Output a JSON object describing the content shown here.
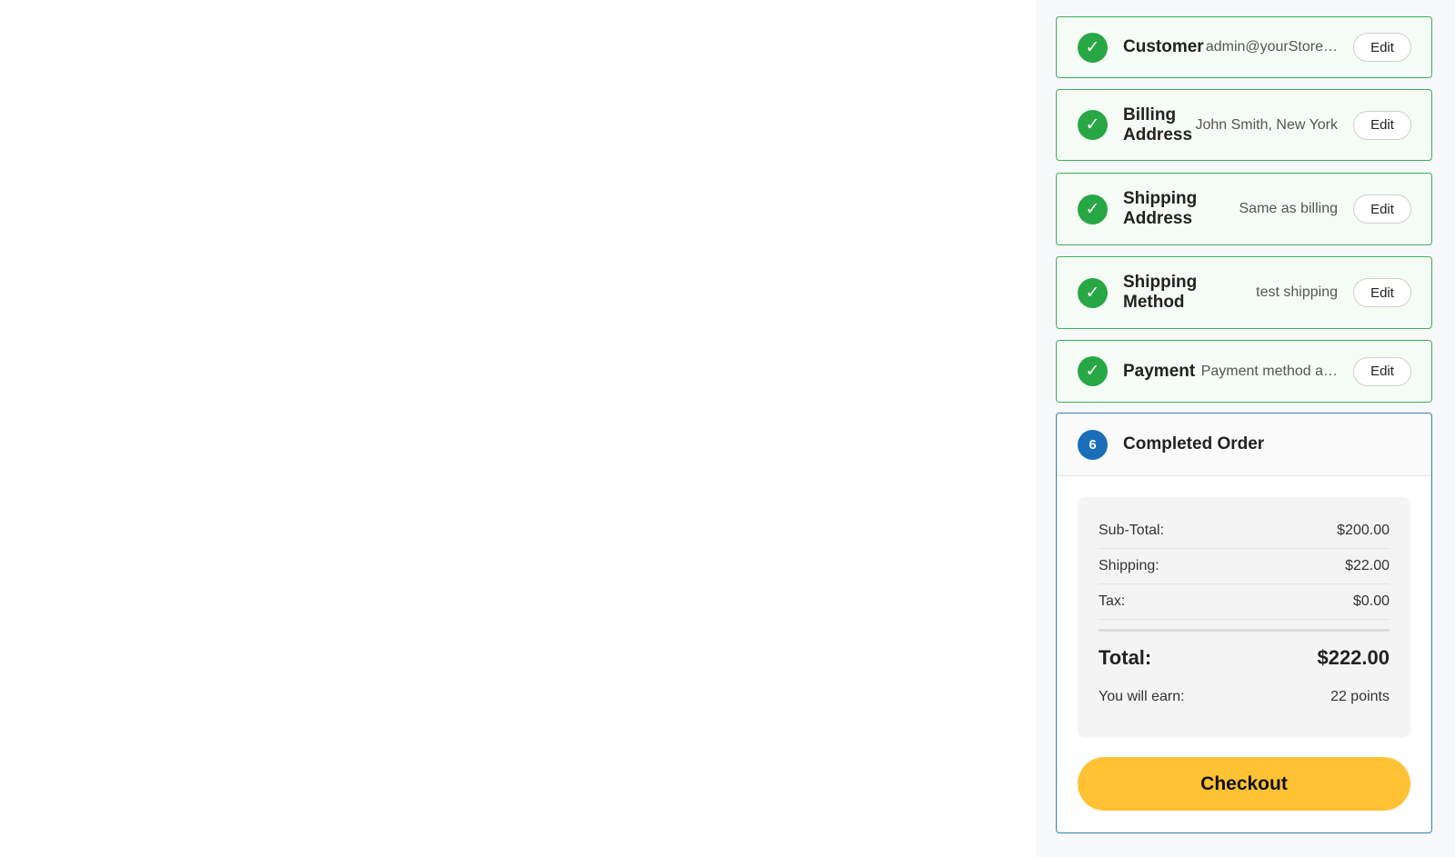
{
  "steps": [
    {
      "title": "Customer",
      "summary": "admin@yourStore…",
      "edit_label": "Edit",
      "status_icon": "check-icon"
    },
    {
      "title": "Billing Address",
      "summary": "John Smith, New York",
      "edit_label": "Edit",
      "status_icon": "check-icon"
    },
    {
      "title": "Shipping Address",
      "summary": "Same as billing",
      "edit_label": "Edit",
      "status_icon": "check-icon"
    },
    {
      "title": "Shipping Method",
      "summary": "test shipping",
      "edit_label": "Edit",
      "status_icon": "check-icon"
    },
    {
      "title": "Payment",
      "summary": "Payment method a…",
      "edit_label": "Edit",
      "status_icon": "check-icon"
    }
  ],
  "order": {
    "step_number": "6",
    "title": "Completed Order",
    "subtotal_label": "Sub-Total:",
    "subtotal_value": "$200.00",
    "shipping_label": "Shipping:",
    "shipping_value": "$22.00",
    "tax_label": "Tax:",
    "tax_value": "$0.00",
    "total_label": "Total:",
    "total_value": "$222.00",
    "earn_label": "You will earn:",
    "earn_value": "22 points",
    "checkout_label": "Checkout"
  },
  "colors": {
    "complete_green": "#28a745",
    "active_blue": "#1a6eb8",
    "checkout_yellow": "#ffc235"
  }
}
